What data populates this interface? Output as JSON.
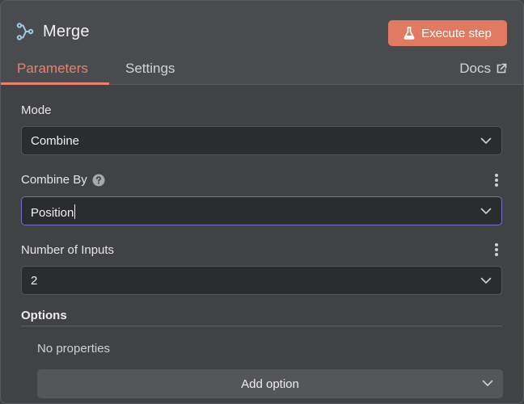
{
  "node": {
    "title": "Merge",
    "icon": "merge-branch-icon",
    "execute_label": "Execute step",
    "execute_icon": "flask-icon",
    "accent_color": "#e07a61"
  },
  "tabs": [
    {
      "label": "Parameters",
      "active": true
    },
    {
      "label": "Settings",
      "active": false
    }
  ],
  "docs": {
    "label": "Docs",
    "icon": "external-link-icon"
  },
  "fields": {
    "mode": {
      "label": "Mode",
      "value": "Combine"
    },
    "combine_by": {
      "label": "Combine By",
      "value": "Position",
      "help_icon": "question-circle-icon"
    },
    "num_inputs": {
      "label": "Number of Inputs",
      "value": "2"
    }
  },
  "options": {
    "title": "Options",
    "empty_text": "No properties",
    "add_label": "Add option"
  }
}
